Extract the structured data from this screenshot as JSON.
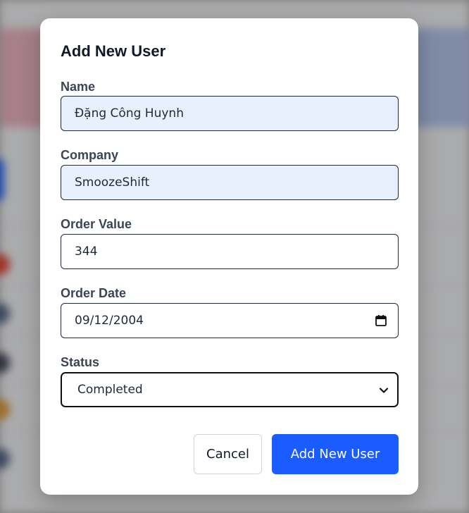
{
  "modal": {
    "title": "Add New User"
  },
  "form": {
    "name": {
      "label": "Name",
      "value": "Đặng Công Huynh"
    },
    "company": {
      "label": "Company",
      "value": "SmoozeShift"
    },
    "order_value": {
      "label": "Order Value",
      "value": "344"
    },
    "order_date": {
      "label": "Order Date",
      "value": "09/12/2004"
    },
    "status": {
      "label": "Status",
      "value": "Completed"
    }
  },
  "buttons": {
    "cancel_label": "Cancel",
    "submit_label": "Add New User"
  },
  "icons": {
    "date": "calendar-icon",
    "select": "chevron-down-icon"
  },
  "colors": {
    "primary": "#1a5cff",
    "autofill_bg": "#e8f0fe"
  }
}
